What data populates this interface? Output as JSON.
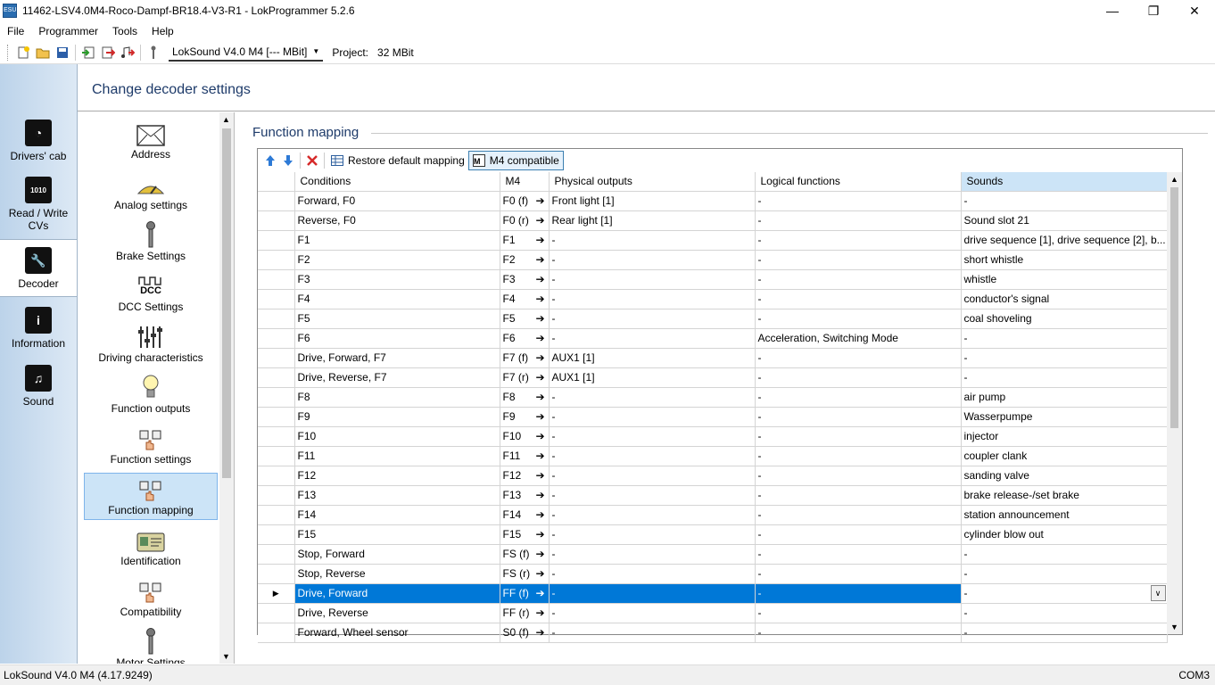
{
  "window": {
    "title": "11462-LSV4.0M4-Roco-Dampf-BR18.4-V3-R1 - LokProgrammer 5.2.6",
    "app_icon_label": "ESU"
  },
  "menu": [
    "File",
    "Programmer",
    "Tools",
    "Help"
  ],
  "toolbar": {
    "decoder_combo": "LokSound V4.0 M4 [--- MBit]",
    "project_label": "Project:",
    "project_value": "32 MBit"
  },
  "left_nav": {
    "items": [
      {
        "label": "Drivers' cab",
        "icon": "speedometer-icon"
      },
      {
        "label": "Read / Write CVs",
        "icon": "binary-icon"
      },
      {
        "label": "Decoder",
        "icon": "wrench-icon",
        "active": true
      },
      {
        "label": "Information",
        "icon": "info-icon"
      },
      {
        "label": "Sound",
        "icon": "music-note-icon"
      }
    ]
  },
  "header": {
    "title": "Change decoder settings"
  },
  "categories": [
    {
      "label": "Address",
      "icon": "envelope-icon"
    },
    {
      "label": "Analog settings",
      "icon": "analog-gauge-icon"
    },
    {
      "label": "Brake Settings",
      "icon": "brake-lever-icon"
    },
    {
      "label": "DCC Settings",
      "icon": "dcc-icon",
      "icon_text": "DCC"
    },
    {
      "label": "Driving characteristics",
      "icon": "sliders-icon"
    },
    {
      "label": "Function outputs",
      "icon": "bulb-icon"
    },
    {
      "label": "Function settings",
      "icon": "hand-buttons-icon"
    },
    {
      "label": "Function mapping",
      "icon": "hand-buttons-icon",
      "active": true
    },
    {
      "label": "Identification",
      "icon": "id-card-icon"
    },
    {
      "label": "Compatibility",
      "icon": "hand-buttons-icon"
    },
    {
      "label": "Motor Settings",
      "icon": "motor-lever-icon"
    }
  ],
  "section": {
    "title": "Function mapping"
  },
  "grid_toolbar": {
    "restore_label": "Restore default mapping",
    "m4_label": "M4 compatible"
  },
  "table": {
    "columns": [
      "Conditions",
      "M4",
      "Physical outputs",
      "Logical functions",
      "Sounds"
    ],
    "rows": [
      {
        "conditions": "Forward, F0",
        "m4": "F0 (f)",
        "physical": "Front light [1]",
        "logical": "-",
        "sounds": "-"
      },
      {
        "conditions": "Reverse, F0",
        "m4": "F0 (r)",
        "physical": "Rear light [1]",
        "logical": "-",
        "sounds": "Sound slot 21"
      },
      {
        "conditions": "F1",
        "m4": "F1",
        "physical": "-",
        "logical": "-",
        "sounds": "drive sequence [1], drive sequence [2], b..."
      },
      {
        "conditions": "F2",
        "m4": "F2",
        "physical": "-",
        "logical": "-",
        "sounds": "short whistle"
      },
      {
        "conditions": "F3",
        "m4": "F3",
        "physical": "-",
        "logical": "-",
        "sounds": "whistle"
      },
      {
        "conditions": "F4",
        "m4": "F4",
        "physical": "-",
        "logical": "-",
        "sounds": "conductor's signal"
      },
      {
        "conditions": "F5",
        "m4": "F5",
        "physical": "-",
        "logical": "-",
        "sounds": "coal shoveling"
      },
      {
        "conditions": "F6",
        "m4": "F6",
        "physical": "-",
        "logical": "Acceleration, Switching Mode",
        "sounds": "-"
      },
      {
        "conditions": "Drive, Forward, F7",
        "m4": "F7 (f)",
        "physical": "AUX1 [1]",
        "logical": "-",
        "sounds": "-"
      },
      {
        "conditions": "Drive, Reverse, F7",
        "m4": "F7 (r)",
        "physical": "AUX1 [1]",
        "logical": "-",
        "sounds": "-"
      },
      {
        "conditions": "F8",
        "m4": "F8",
        "physical": "-",
        "logical": "-",
        "sounds": "air pump"
      },
      {
        "conditions": "F9",
        "m4": "F9",
        "physical": "-",
        "logical": "-",
        "sounds": "Wasserpumpe"
      },
      {
        "conditions": "F10",
        "m4": "F10",
        "physical": "-",
        "logical": "-",
        "sounds": "injector"
      },
      {
        "conditions": "F11",
        "m4": "F11",
        "physical": "-",
        "logical": "-",
        "sounds": "coupler clank"
      },
      {
        "conditions": "F12",
        "m4": "F12",
        "physical": "-",
        "logical": "-",
        "sounds": "sanding valve"
      },
      {
        "conditions": "F13",
        "m4": "F13",
        "physical": "-",
        "logical": "-",
        "sounds": "brake release-/set brake"
      },
      {
        "conditions": "F14",
        "m4": "F14",
        "physical": "-",
        "logical": "-",
        "sounds": "station announcement"
      },
      {
        "conditions": "F15",
        "m4": "F15",
        "physical": "-",
        "logical": "-",
        "sounds": "cylinder blow out"
      },
      {
        "conditions": "Stop, Forward",
        "m4": "FS (f)",
        "physical": "-",
        "logical": "-",
        "sounds": "-"
      },
      {
        "conditions": "Stop, Reverse",
        "m4": "FS (r)",
        "physical": "-",
        "logical": "-",
        "sounds": "-"
      },
      {
        "conditions": "Drive, Forward",
        "m4": "FF (f)",
        "physical": "-",
        "logical": "-",
        "sounds": "-",
        "selected": true
      },
      {
        "conditions": "Drive, Reverse",
        "m4": "FF (r)",
        "physical": "-",
        "logical": "-",
        "sounds": "-"
      },
      {
        "conditions": "Forward, Wheel sensor",
        "m4": "S0 (f)",
        "physical": "-",
        "logical": "-",
        "sounds": "-"
      }
    ]
  },
  "status": {
    "left": "LokSound V4.0 M4 (4.17.9249)",
    "right": "COM3"
  }
}
